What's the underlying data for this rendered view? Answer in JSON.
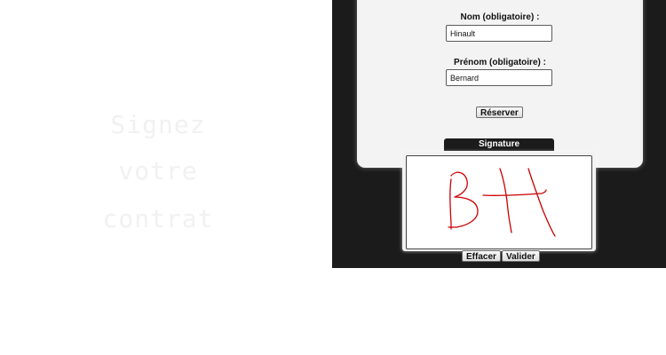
{
  "promo": {
    "lines": [
      "Signez",
      "votre",
      "contrat"
    ]
  },
  "form": {
    "nom_label": "Nom (obligatoire) :",
    "nom_value": "Hinault",
    "prenom_label": "Prénom (obligatoire) :",
    "prenom_value": "Bernard",
    "reserve_button": "Réserver"
  },
  "signature": {
    "header": "Signature",
    "ink_color": "#cc0000",
    "clear_button": "Effacer",
    "validate_button": "Valider"
  },
  "colors": {
    "device_background": "#1b1b1b",
    "panel_background": "#f3f3f3",
    "promo_text": "#f1f1f1"
  }
}
